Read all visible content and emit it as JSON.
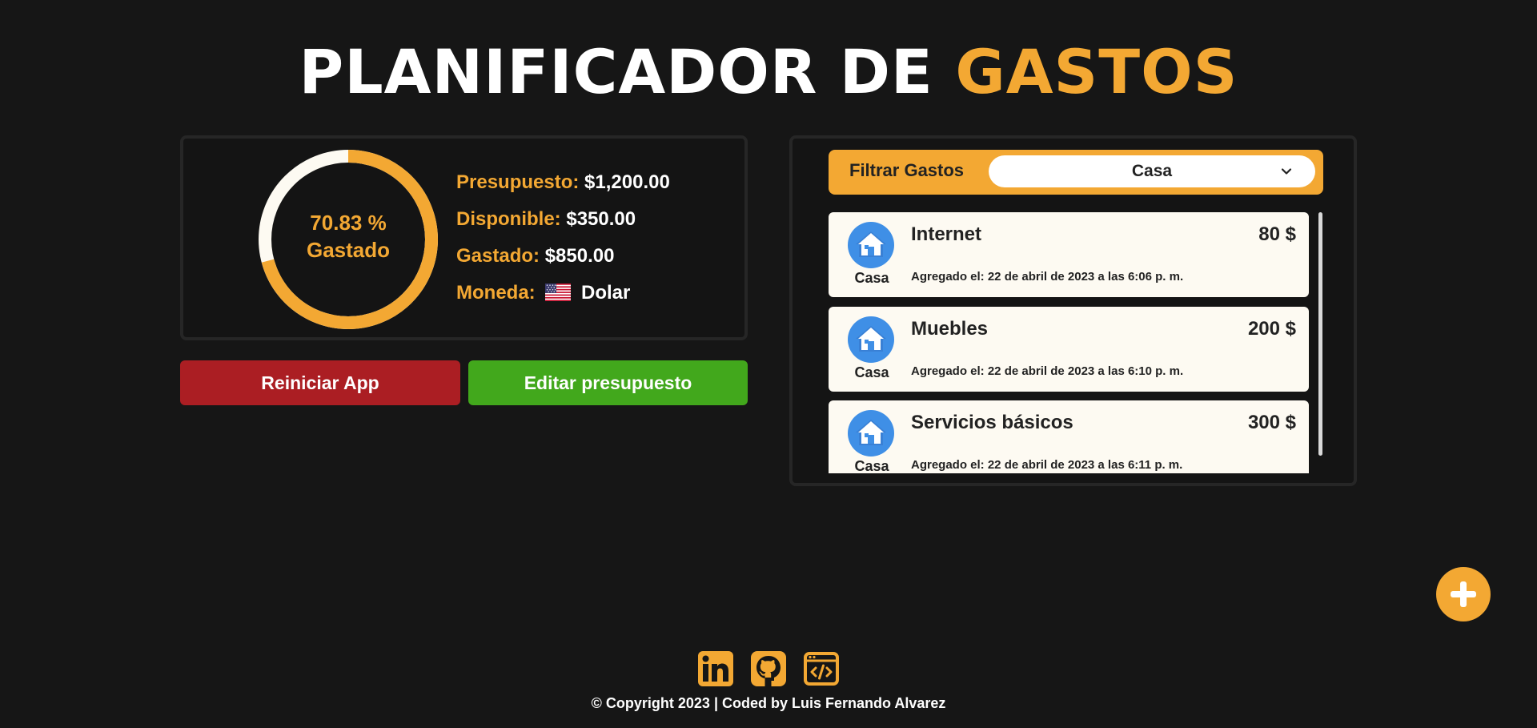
{
  "header": {
    "title_main": "PLANIFICADOR DE",
    "title_accent": "GASTOS"
  },
  "budget": {
    "percent_spent": 70.83,
    "percent_text": "70.83 %",
    "spent_caption": "Gastado",
    "presupuesto_label": "Presupuesto:",
    "presupuesto_value": "$1,200.00",
    "disponible_label": "Disponible:",
    "disponible_value": "$350.00",
    "gastado_label": "Gastado:",
    "gastado_value": "$850.00",
    "moneda_label": "Moneda:",
    "moneda_value": "Dolar",
    "moneda_icon": "us-flag-icon"
  },
  "actions": {
    "reset_label": "Reiniciar App",
    "edit_label": "Editar presupuesto"
  },
  "filter": {
    "label": "Filtrar Gastos",
    "selected": "Casa"
  },
  "expenses": [
    {
      "category": "Casa",
      "icon": "house-icon",
      "name": "Internet",
      "amount": "80 $",
      "date": "Agregado el: 22 de abril de 2023 a las 6:06 p. m."
    },
    {
      "category": "Casa",
      "icon": "house-icon",
      "name": "Muebles",
      "amount": "200 $",
      "date": "Agregado el: 22 de abril de 2023 a las 6:10 p. m."
    },
    {
      "category": "Casa",
      "icon": "house-icon",
      "name": "Servicios básicos",
      "amount": "300 $",
      "date": "Agregado el: 22 de abril de 2023 a las 6:11 p. m."
    }
  ],
  "footer": {
    "copyright": "© Copyright 2023 | Coded by Luis Fernando Alvarez",
    "social_icons": [
      "linkedin-icon",
      "github-icon",
      "portfolio-code-icon"
    ]
  },
  "colors": {
    "background": "#161616",
    "accent": "#f3a833",
    "danger": "#ab1e23",
    "success": "#42a81c",
    "card": "#fdfaf2"
  }
}
